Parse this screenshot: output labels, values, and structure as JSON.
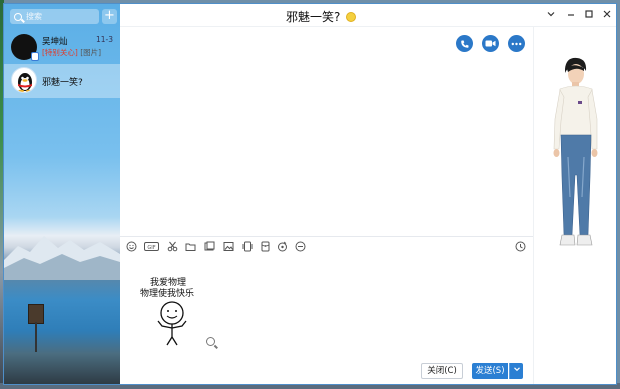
{
  "search": {
    "placeholder": "搜索"
  },
  "contacts": [
    {
      "name": "吴坤灿",
      "time": "11-3",
      "tag": "[特别关心]",
      "preview": "[图片]"
    },
    {
      "name": "邪魅一笑?"
    }
  ],
  "chat": {
    "title": "邪魅一笑?"
  },
  "sticker": {
    "line1": "我爱物理",
    "line2": "物理使我快乐"
  },
  "buttons": {
    "close": "关闭(C)",
    "send": "发送(S)"
  },
  "colors": {
    "accent": "#2b7fd3",
    "special_tag": "#e03a2a"
  },
  "icons": {
    "window": [
      "chevron-down-icon",
      "minimize-icon",
      "maximize-icon",
      "close-icon"
    ],
    "call": [
      "phone-icon",
      "video-icon",
      "more-icon"
    ],
    "toolbar": [
      "emoji-icon",
      "gif-icon",
      "scissors-icon",
      "folder-icon",
      "photo-album-icon",
      "image-icon",
      "screen-share-icon",
      "red-packet-icon",
      "music-icon",
      "more-icon",
      "history-icon"
    ]
  }
}
